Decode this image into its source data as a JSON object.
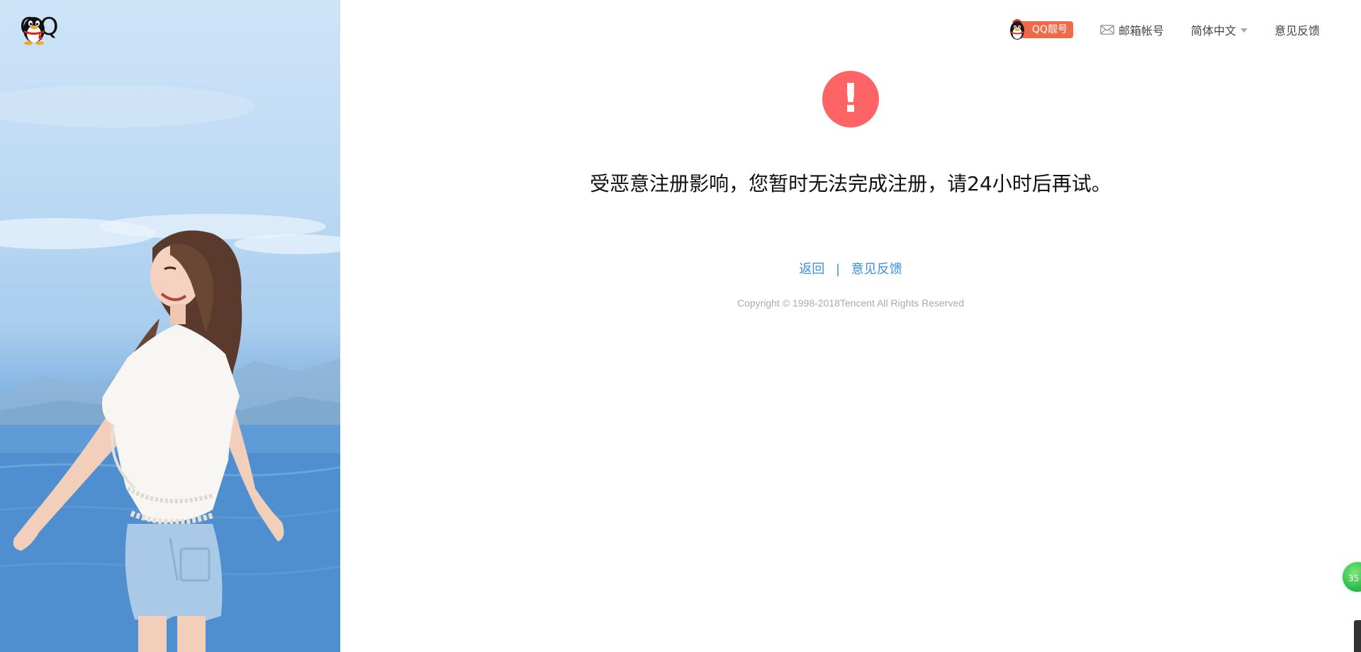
{
  "logo": {
    "text": "QQ",
    "icon": "penguin-icon"
  },
  "nav": {
    "qq_liang": "QQ靓号",
    "mail": "邮箱帐号",
    "language": "简体中文",
    "feedback": "意见反馈"
  },
  "alert": {
    "icon_text": "!",
    "message": "受恶意注册影响，您暂时无法完成注册，请24小时后再试。"
  },
  "links": {
    "back": "返回",
    "separator": "|",
    "feedback": "意见反馈"
  },
  "footer": {
    "copyright": "Copyright © 1998-2018Tencent All Rights Reserved"
  },
  "floating": {
    "ball_text": "35"
  },
  "colors": {
    "alert_red": "#fe6365",
    "link_blue": "#3a8ee6",
    "badge_orange": "#f06a4a"
  }
}
